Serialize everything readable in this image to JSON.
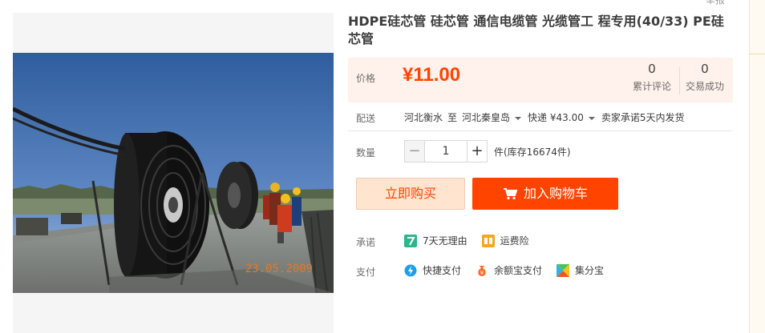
{
  "report_link": "举报",
  "product": {
    "title": "HDPE硅芯管 硅芯管 通信电缆管 光缆管工 程专用(40/33) PE硅芯管",
    "photo_stamp": "23.05.2009"
  },
  "price": {
    "label": "价格",
    "value": "¥11.00",
    "reviews_count": "0",
    "reviews_label": "累计评论",
    "sales_count": "0",
    "sales_label": "交易成功"
  },
  "shipping": {
    "label": "配送",
    "origin": "河北衡水",
    "to": "至",
    "destination": "河北秦皇岛",
    "method": "快递 ¥43.00",
    "promise": "卖家承诺5天内发货"
  },
  "quantity": {
    "label": "数量",
    "minus": "−",
    "value": "1",
    "plus": "+",
    "unit_stock": "件(库存16674件)"
  },
  "actions": {
    "buy_now": "立即购买",
    "add_cart": "加入购物车"
  },
  "promises": {
    "label": "承诺",
    "items": [
      "7天无理由",
      "运费险"
    ]
  },
  "payment": {
    "label": "支付",
    "items": [
      "快捷支付",
      "余额宝支付",
      "集分宝"
    ]
  },
  "colors": {
    "accent": "#ff4400",
    "price_bg": "#fff1eb",
    "buy_bg": "#ffe4d0"
  },
  "icons": [
    "seven-day-icon",
    "freight-insurance-icon",
    "quick-pay-icon",
    "yuebao-icon",
    "jifenbao-icon",
    "cart-icon"
  ]
}
